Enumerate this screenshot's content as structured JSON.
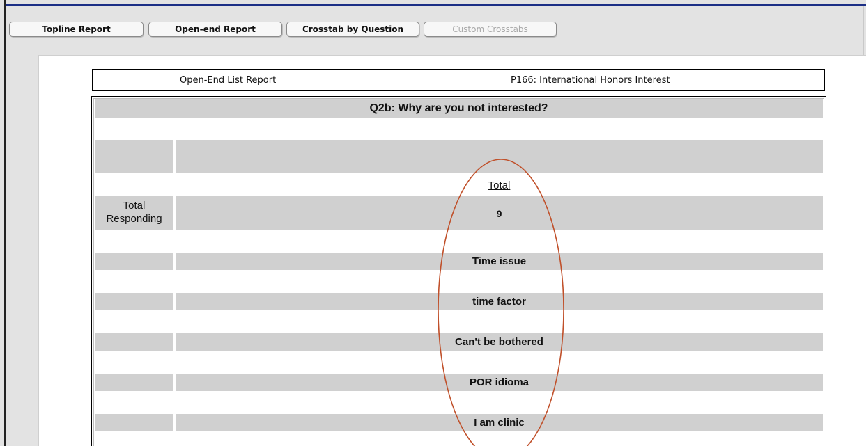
{
  "tabs": [
    {
      "label": "Topline Report",
      "enabled": true
    },
    {
      "label": "Open-end Report",
      "enabled": true
    },
    {
      "label": "Crosstab by Question",
      "enabled": true
    },
    {
      "label": "Custom Crosstabs",
      "enabled": false
    }
  ],
  "report_header": {
    "report_type": "Open-End List Report",
    "project": "P166: International Honors Interest"
  },
  "question": {
    "title": "Q2b: Why are you not interested?"
  },
  "table": {
    "column_header": "Total",
    "total_responding_label": "Total Responding",
    "total_responding_value": "9",
    "responses": [
      "Time issue",
      "time factor",
      "Can't be bothered",
      "POR idioma",
      "I am clinic"
    ]
  },
  "colors": {
    "header_rule": "#1c2f86",
    "row_band": "#d0d0d0",
    "annotation_oval": "#c0502a"
  }
}
